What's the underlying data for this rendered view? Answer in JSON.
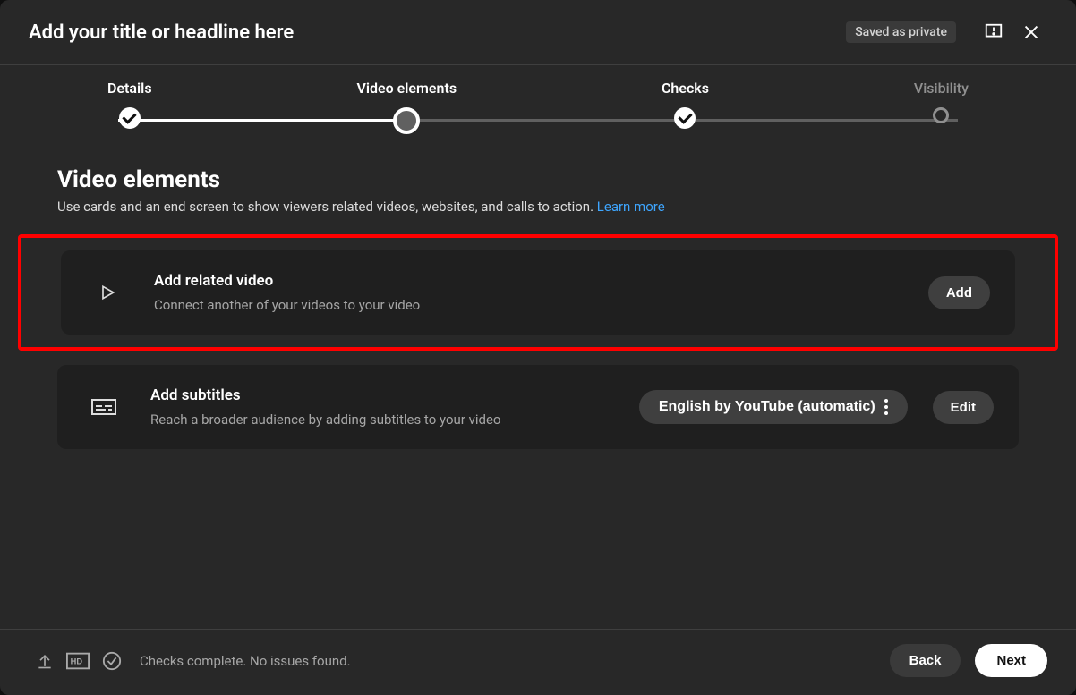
{
  "header": {
    "title": "Add your title or headline here",
    "saved_label": "Saved as private"
  },
  "stepper": {
    "steps": [
      {
        "label": "Details",
        "state": "done"
      },
      {
        "label": "Video elements",
        "state": "current"
      },
      {
        "label": "Checks",
        "state": "done"
      },
      {
        "label": "Visibility",
        "state": "future"
      }
    ],
    "progress_percent": 33
  },
  "section": {
    "title": "Video elements",
    "description": "Use cards and an end screen to show viewers related videos, websites, and calls to action.",
    "learn_more": "Learn more"
  },
  "cards": {
    "related": {
      "title": "Add related video",
      "description": "Connect another of your videos to your video",
      "action": "Add",
      "highlighted": true
    },
    "subtitles": {
      "title": "Add subtitles",
      "description": "Reach a broader audience by adding subtitles to your video",
      "language_pill": "English by YouTube (automatic)",
      "action": "Edit"
    }
  },
  "footer": {
    "status": "Checks complete. No issues found.",
    "back": "Back",
    "next": "Next"
  }
}
